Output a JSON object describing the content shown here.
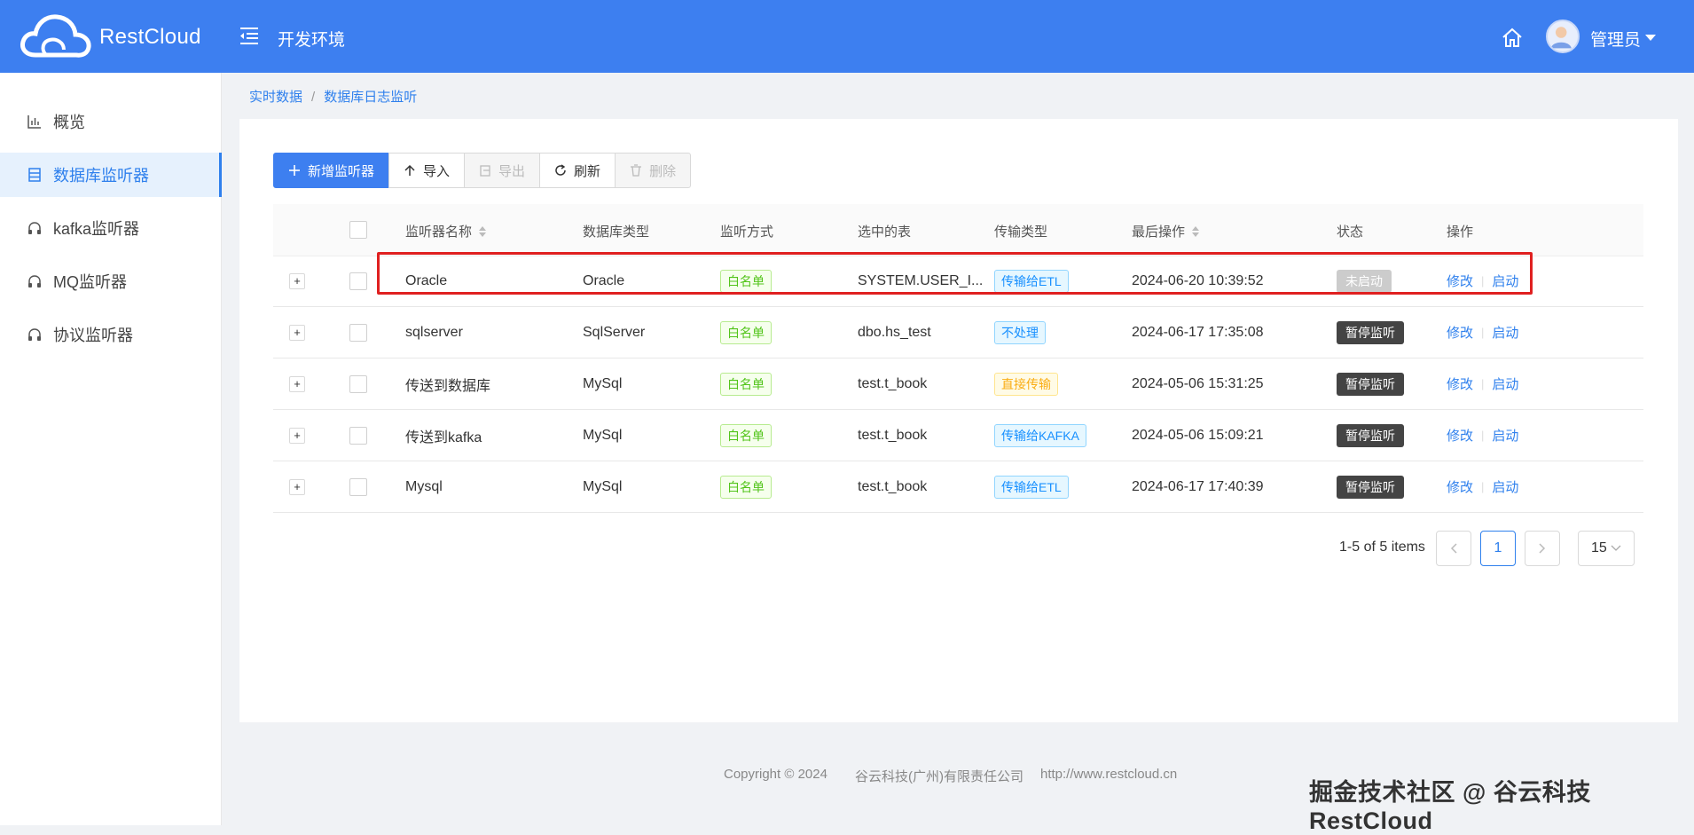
{
  "header": {
    "app_name": "RestCloud",
    "env_label": "开发环境",
    "user_name": "管理员",
    "bg_color": "#3d7ff0"
  },
  "sidebar": {
    "items": [
      {
        "label": "概览",
        "icon": "bar-chart-icon",
        "active": false
      },
      {
        "label": "数据库监听器",
        "icon": "database-icon",
        "active": true
      },
      {
        "label": "kafka监听器",
        "icon": "headset-icon",
        "active": false
      },
      {
        "label": "MQ监听器",
        "icon": "headset-icon",
        "active": false
      },
      {
        "label": "协议监听器",
        "icon": "headset-icon",
        "active": false
      }
    ]
  },
  "breadcrumb": [
    "实时数据",
    "数据库日志监听"
  ],
  "toolbar": {
    "add_label": "新增监听器",
    "import_label": "导入",
    "export_label": "导出",
    "refresh_label": "刷新",
    "delete_label": "删除"
  },
  "table": {
    "columns": [
      "监听器名称",
      "数据库类型",
      "监听方式",
      "选中的表",
      "传输类型",
      "最后操作",
      "状态",
      "操作"
    ],
    "rows": [
      {
        "name": "Oracle",
        "db_type": "Oracle",
        "mode": "白名单",
        "table": "SYSTEM.USER_I...",
        "transfer": "传输给ETL",
        "transfer_color": "blue",
        "last_op": "2024-06-20 10:39:52",
        "status": "未启动",
        "status_style": "gray",
        "edit": "修改",
        "start": "启动"
      },
      {
        "name": "sqlserver",
        "db_type": "SqlServer",
        "mode": "白名单",
        "table": "dbo.hs_test",
        "transfer": "不处理",
        "transfer_color": "blue",
        "last_op": "2024-06-17 17:35:08",
        "status": "暂停监听",
        "status_style": "dark",
        "edit": "修改",
        "start": "启动"
      },
      {
        "name": "传送到数据库",
        "db_type": "MySql",
        "mode": "白名单",
        "table": "test.t_book",
        "transfer": "直接传输",
        "transfer_color": "gold",
        "last_op": "2024-05-06 15:31:25",
        "status": "暂停监听",
        "status_style": "dark",
        "edit": "修改",
        "start": "启动"
      },
      {
        "name": "传送到kafka",
        "db_type": "MySql",
        "mode": "白名单",
        "table": "test.t_book",
        "transfer": "传输给KAFKA",
        "transfer_color": "blue",
        "last_op": "2024-05-06 15:09:21",
        "status": "暂停监听",
        "status_style": "dark",
        "edit": "修改",
        "start": "启动"
      },
      {
        "name": "Mysql",
        "db_type": "MySql",
        "mode": "白名单",
        "table": "test.t_book",
        "transfer": "传输给ETL",
        "transfer_color": "blue",
        "last_op": "2024-06-17 17:40:39",
        "status": "暂停监听",
        "status_style": "dark",
        "edit": "修改",
        "start": "启动"
      }
    ]
  },
  "pagination": {
    "info": "1-5 of 5 items",
    "current_page": "1",
    "page_size": "15"
  },
  "footer": {
    "copyright": "Copyright © 2024",
    "company": "谷云科技(广州)有限责任公司",
    "url": "http://www.restcloud.cn"
  },
  "watermark": "掘金技术社区 @ 谷云科技RestCloud"
}
